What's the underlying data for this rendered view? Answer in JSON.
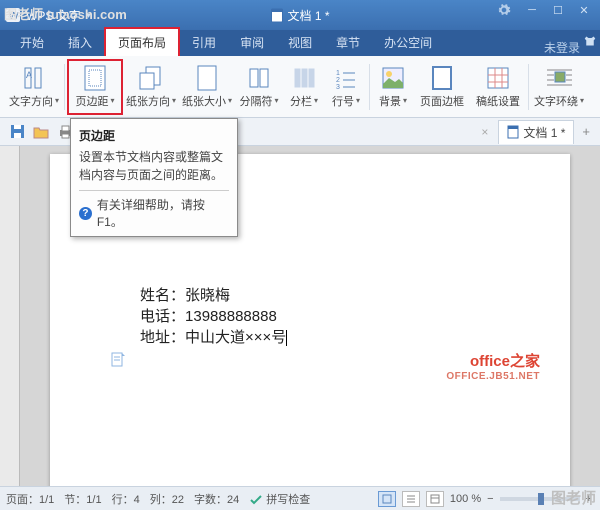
{
  "watermarks": {
    "tl": "图老师 tulaoshi.com",
    "office": "office之家",
    "office_sub": "OFFICE.JB51.NET",
    "br": "图老师"
  },
  "titlebar": {
    "app": "WPS 文字",
    "doc": "文档 1 *"
  },
  "menubar": {
    "items": [
      "开始",
      "插入",
      "页面布局",
      "引用",
      "审阅",
      "视图",
      "章节",
      "办公空间"
    ],
    "login": "未登录"
  },
  "ribbon": {
    "buttons": [
      {
        "label": "文字方向",
        "caret": true
      },
      {
        "label": "页边距",
        "caret": true
      },
      {
        "label": "纸张方向",
        "caret": true
      },
      {
        "label": "纸张大小",
        "caret": true
      },
      {
        "label": "分隔符",
        "caret": true
      },
      {
        "label": "分栏",
        "caret": true
      },
      {
        "label": "行号",
        "caret": true
      },
      {
        "label": "背景",
        "caret": true
      },
      {
        "label": "页面边框",
        "caret": false
      },
      {
        "label": "稿纸设置",
        "caret": false
      },
      {
        "label": "文字环绕",
        "caret": true
      }
    ]
  },
  "qat_tabs": {
    "doc": "文档 1 *"
  },
  "tooltip": {
    "title": "页边距",
    "body": "设置本节文档内容或整篇文档内容与页面之间的距离。",
    "help": "有关详细帮助，请按F1。"
  },
  "document": {
    "line1_label": "姓名：",
    "line1_val": "张晓梅",
    "line2_label": "电话：",
    "line2_val": "13988888888",
    "line3_label": "地址：",
    "line3_val": "中山大道×××号"
  },
  "statusbar": {
    "page": "页面：1/1",
    "sec": "节：1/1",
    "row": "行：4",
    "col": "列：22",
    "words": "字数：24",
    "spell": "拼写检查",
    "zoom": "100 %"
  }
}
